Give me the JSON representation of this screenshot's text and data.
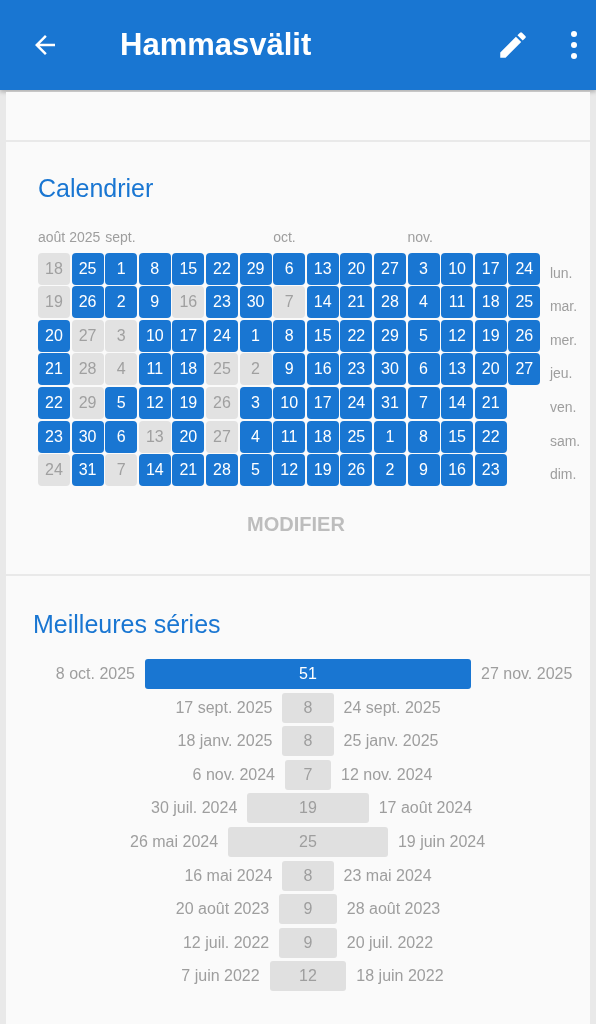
{
  "app_bar": {
    "title": "Hammasvälit"
  },
  "calendar": {
    "title": "Calendrier",
    "columns": [
      {
        "month": "août 2025",
        "days": [
          {
            "day": "18",
            "done": false
          },
          {
            "day": "19",
            "done": false
          },
          {
            "day": "20",
            "done": true
          },
          {
            "day": "21",
            "done": true
          },
          {
            "day": "22",
            "done": true
          },
          {
            "day": "23",
            "done": true
          },
          {
            "day": "24",
            "done": false
          }
        ]
      },
      {
        "days": [
          {
            "day": "25",
            "done": true
          },
          {
            "day": "26",
            "done": true
          },
          {
            "day": "27",
            "done": false
          },
          {
            "day": "28",
            "done": false
          },
          {
            "day": "29",
            "done": false
          },
          {
            "day": "30",
            "done": true
          },
          {
            "day": "31",
            "done": true
          }
        ]
      },
      {
        "month": "sept.",
        "days": [
          {
            "day": "1",
            "done": true
          },
          {
            "day": "2",
            "done": true
          },
          {
            "day": "3",
            "done": false
          },
          {
            "day": "4",
            "done": false
          },
          {
            "day": "5",
            "done": true
          },
          {
            "day": "6",
            "done": true
          },
          {
            "day": "7",
            "done": false
          }
        ]
      },
      {
        "days": [
          {
            "day": "8",
            "done": true
          },
          {
            "day": "9",
            "done": true
          },
          {
            "day": "10",
            "done": true
          },
          {
            "day": "11",
            "done": true
          },
          {
            "day": "12",
            "done": true
          },
          {
            "day": "13",
            "done": false
          },
          {
            "day": "14",
            "done": true
          }
        ]
      },
      {
        "days": [
          {
            "day": "15",
            "done": true
          },
          {
            "day": "16",
            "done": false
          },
          {
            "day": "17",
            "done": true
          },
          {
            "day": "18",
            "done": true
          },
          {
            "day": "19",
            "done": true
          },
          {
            "day": "20",
            "done": true
          },
          {
            "day": "21",
            "done": true
          }
        ]
      },
      {
        "days": [
          {
            "day": "22",
            "done": true
          },
          {
            "day": "23",
            "done": true
          },
          {
            "day": "24",
            "done": true
          },
          {
            "day": "25",
            "done": false
          },
          {
            "day": "26",
            "done": false
          },
          {
            "day": "27",
            "done": false
          },
          {
            "day": "28",
            "done": true
          }
        ]
      },
      {
        "days": [
          {
            "day": "29",
            "done": true
          },
          {
            "day": "30",
            "done": true
          },
          {
            "day": "1",
            "done": true
          },
          {
            "day": "2",
            "done": false
          },
          {
            "day": "3",
            "done": true
          },
          {
            "day": "4",
            "done": true
          },
          {
            "day": "5",
            "done": true
          }
        ]
      },
      {
        "month": "oct.",
        "days": [
          {
            "day": "6",
            "done": true
          },
          {
            "day": "7",
            "done": false
          },
          {
            "day": "8",
            "done": true
          },
          {
            "day": "9",
            "done": true
          },
          {
            "day": "10",
            "done": true
          },
          {
            "day": "11",
            "done": true
          },
          {
            "day": "12",
            "done": true
          }
        ]
      },
      {
        "days": [
          {
            "day": "13",
            "done": true
          },
          {
            "day": "14",
            "done": true
          },
          {
            "day": "15",
            "done": true
          },
          {
            "day": "16",
            "done": true
          },
          {
            "day": "17",
            "done": true
          },
          {
            "day": "18",
            "done": true
          },
          {
            "day": "19",
            "done": true
          }
        ]
      },
      {
        "days": [
          {
            "day": "20",
            "done": true
          },
          {
            "day": "21",
            "done": true
          },
          {
            "day": "22",
            "done": true
          },
          {
            "day": "23",
            "done": true
          },
          {
            "day": "24",
            "done": true
          },
          {
            "day": "25",
            "done": true
          },
          {
            "day": "26",
            "done": true
          }
        ]
      },
      {
        "days": [
          {
            "day": "27",
            "done": true
          },
          {
            "day": "28",
            "done": true
          },
          {
            "day": "29",
            "done": true
          },
          {
            "day": "30",
            "done": true
          },
          {
            "day": "31",
            "done": true
          },
          {
            "day": "1",
            "done": true
          },
          {
            "day": "2",
            "done": true
          }
        ]
      },
      {
        "month": "nov.",
        "days": [
          {
            "day": "3",
            "done": true
          },
          {
            "day": "4",
            "done": true
          },
          {
            "day": "5",
            "done": true
          },
          {
            "day": "6",
            "done": true
          },
          {
            "day": "7",
            "done": true
          },
          {
            "day": "8",
            "done": true
          },
          {
            "day": "9",
            "done": true
          }
        ]
      },
      {
        "days": [
          {
            "day": "10",
            "done": true
          },
          {
            "day": "11",
            "done": true
          },
          {
            "day": "12",
            "done": true
          },
          {
            "day": "13",
            "done": true
          },
          {
            "day": "14",
            "done": true
          },
          {
            "day": "15",
            "done": true
          },
          {
            "day": "16",
            "done": true
          }
        ]
      },
      {
        "days": [
          {
            "day": "17",
            "done": true
          },
          {
            "day": "18",
            "done": true
          },
          {
            "day": "19",
            "done": true
          },
          {
            "day": "20",
            "done": true
          },
          {
            "day": "21",
            "done": true
          },
          {
            "day": "22",
            "done": true
          },
          {
            "day": "23",
            "done": true
          }
        ]
      },
      {
        "days": [
          {
            "day": "24",
            "done": true
          },
          {
            "day": "25",
            "done": true
          },
          {
            "day": "26",
            "done": true
          },
          {
            "day": "27",
            "done": true
          }
        ]
      }
    ],
    "weekdays": [
      "lun.",
      "mar.",
      "mer.",
      "jeu.",
      "ven.",
      "sam.",
      "dim."
    ],
    "edit_button": "MODIFIER"
  },
  "streaks": {
    "title": "Meilleures séries",
    "items": [
      {
        "start": "8 oct. 2025",
        "length": "51",
        "end": "27 nov. 2025",
        "current": true
      },
      {
        "start": "17 sept. 2025",
        "length": "8",
        "end": "24 sept. 2025",
        "current": false
      },
      {
        "start": "18 janv. 2025",
        "length": "8",
        "end": "25 janv. 2025",
        "current": false
      },
      {
        "start": "6 nov. 2024",
        "length": "7",
        "end": "12 nov. 2024",
        "current": false
      },
      {
        "start": "30 juil. 2024",
        "length": "19",
        "end": "17 août 2024",
        "current": false
      },
      {
        "start": "26 mai 2024",
        "length": "25",
        "end": "19 juin 2024",
        "current": false
      },
      {
        "start": "16 mai 2024",
        "length": "8",
        "end": "23 mai 2024",
        "current": false
      },
      {
        "start": "20 août 2023",
        "length": "9",
        "end": "28 août 2023",
        "current": false
      },
      {
        "start": "12 juil. 2022",
        "length": "9",
        "end": "20 juil. 2022",
        "current": false
      },
      {
        "start": "7 juin 2022",
        "length": "12",
        "end": "18 juin 2022",
        "current": false
      }
    ]
  }
}
